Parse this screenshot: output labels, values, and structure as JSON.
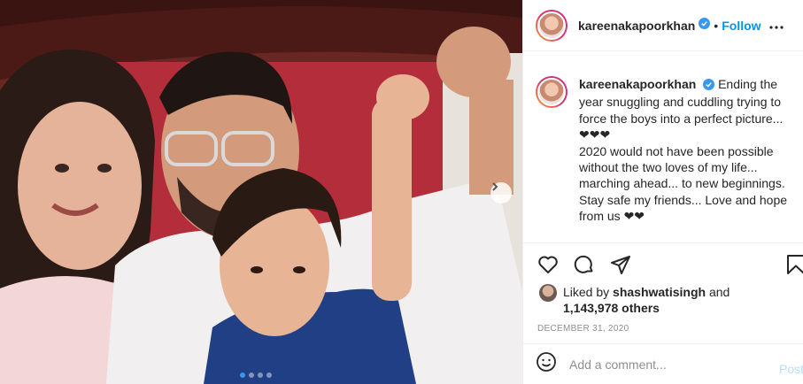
{
  "post": {
    "username": "kareenakapoorkhan",
    "follow_label": "Follow",
    "bullet": "•",
    "caption_lines": [
      "Ending the",
      "year snuggling and cuddling trying to",
      "force the boys into a perfect picture...",
      "❤❤❤",
      "2020 would not have been possible",
      "without the two loves of my life...",
      "marching ahead... to new beginnings.",
      "Stay safe my friends... Love and hope",
      "from us ❤❤"
    ],
    "likes": {
      "prefix": "Liked by",
      "liker": "shashwatisingh",
      "joiner": "and",
      "count": "1,143,978 others"
    },
    "date": "DECEMBER 31, 2020",
    "comment_placeholder": "Add a comment...",
    "post_label": "Post",
    "carousel": {
      "slides": 4,
      "active_index": 0
    }
  },
  "icons": {
    "verified": "verified-badge-icon",
    "more": "more-options-icon",
    "like": "heart-icon",
    "comment": "comment-icon",
    "share": "share-icon",
    "save": "bookmark-icon",
    "emoji": "emoji-icon",
    "next": "chevron-right-icon"
  },
  "colors": {
    "accent": "#0095f6",
    "verified": "#3897f0",
    "muted": "#8e8e8e",
    "post_disabled": "#b2dffc"
  }
}
